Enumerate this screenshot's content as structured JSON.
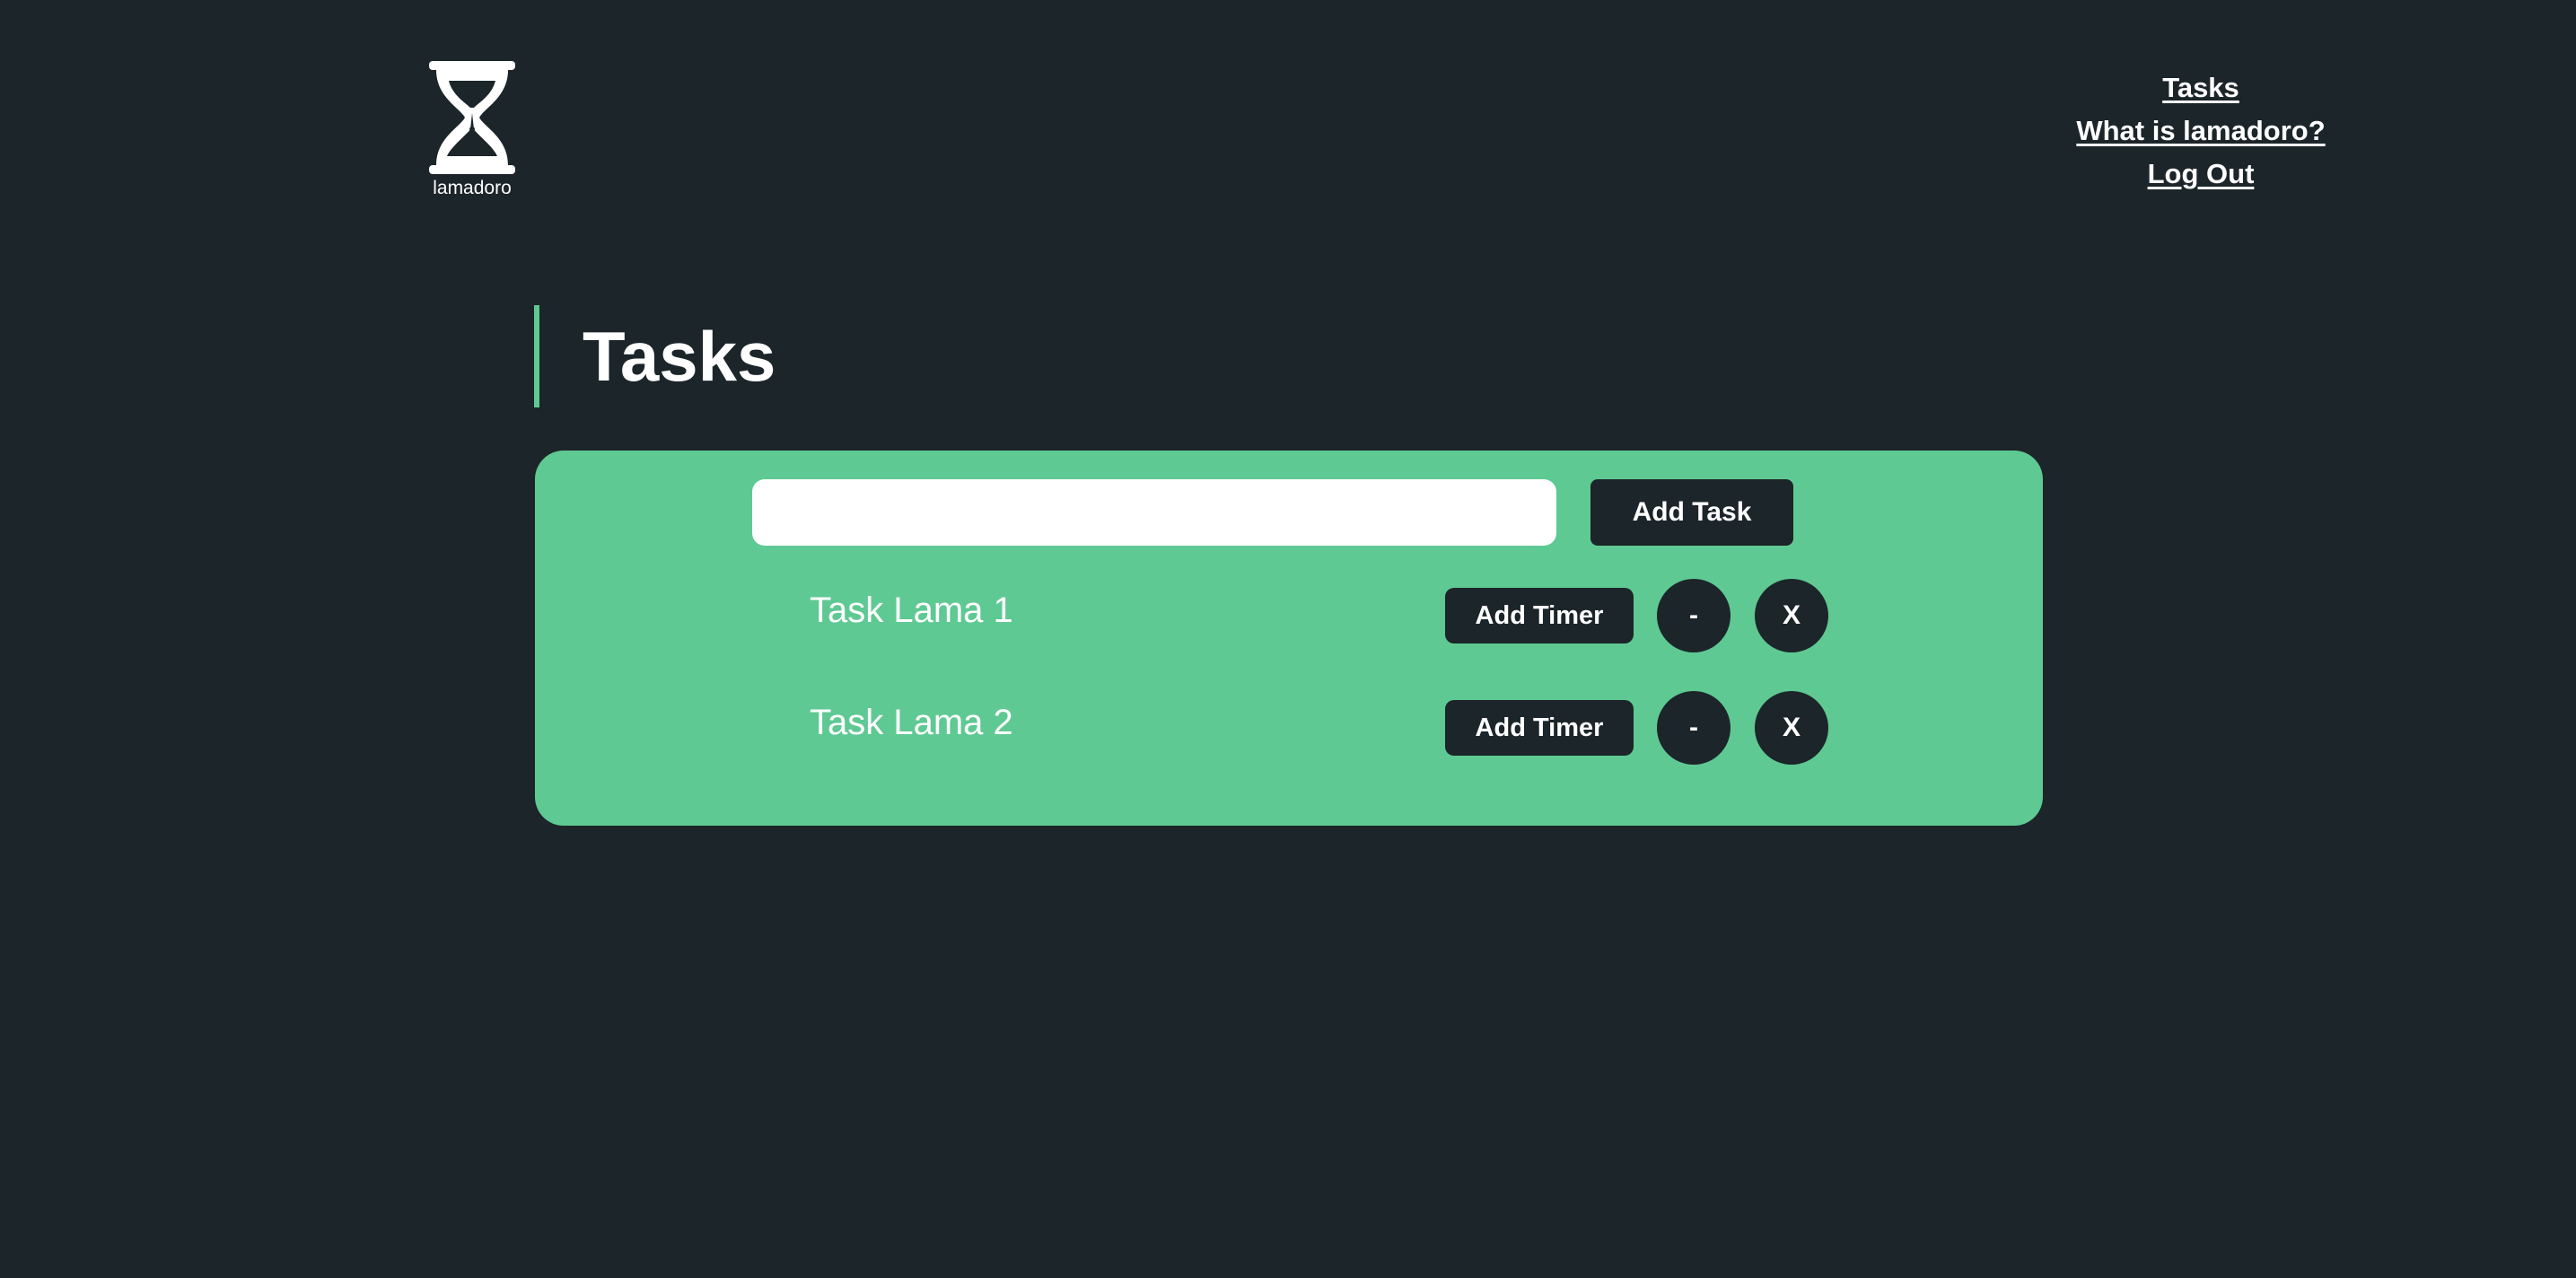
{
  "brand": {
    "name": "lamadoro"
  },
  "nav": {
    "items": [
      {
        "label": "Tasks"
      },
      {
        "label": "What is lamadoro?"
      },
      {
        "label": "Log Out"
      }
    ]
  },
  "page": {
    "title": "Tasks"
  },
  "task_form": {
    "input_value": "",
    "input_placeholder": "",
    "add_task_label": "Add Task"
  },
  "tasks": [
    {
      "name": "Task Lama 1",
      "add_timer_label": "Add Timer",
      "minus_label": "-",
      "delete_label": "X"
    },
    {
      "name": "Task Lama 2",
      "add_timer_label": "Add Timer",
      "minus_label": "-",
      "delete_label": "X"
    }
  ],
  "colors": {
    "background": "#1c2529",
    "accent": "#5fc993",
    "text": "#ffffff"
  },
  "icons": {
    "logo": "hourglass-icon"
  }
}
